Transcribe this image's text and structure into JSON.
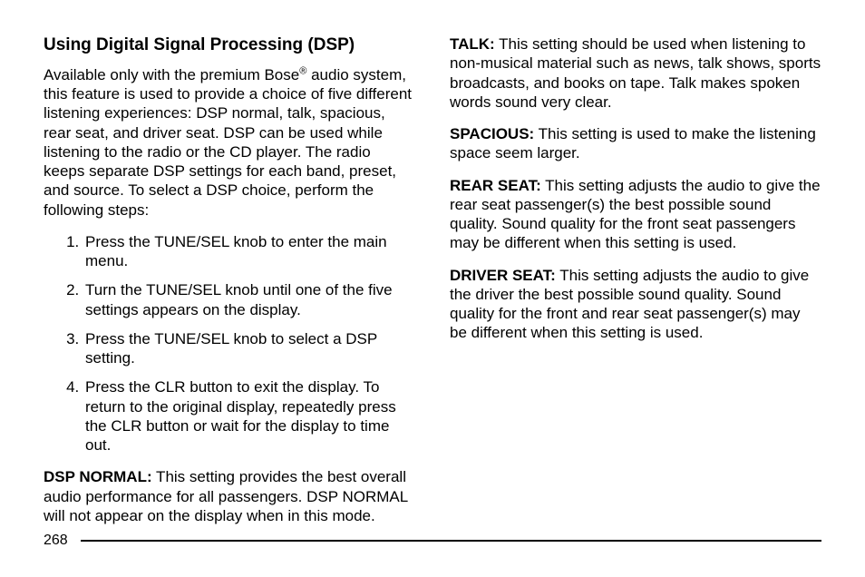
{
  "left": {
    "heading": "Using Digital Signal Processing (DSP)",
    "intro_a": "Available only with the premium Bose",
    "intro_sup": "®",
    "intro_b": " audio system, this feature is used to provide a choice of five different listening experiences: DSP normal, talk, spacious, rear seat, and driver seat. DSP can be used while listening to the radio or the CD player. The radio keeps separate DSP settings for each band, preset, and source. To select a DSP choice, perform the following steps:",
    "steps": [
      "Press the TUNE/SEL knob to enter the main menu.",
      "Turn the TUNE/SEL knob until one of the five settings appears on the display.",
      "Press the TUNE/SEL knob to select a DSP setting.",
      "Press the CLR button to exit the display. To return to the original display, repeatedly press the CLR button or wait for the display to time out."
    ],
    "dsp_normal_label": "DSP NORMAL:",
    "dsp_normal_text": "  This setting provides the best overall audio performance for all passengers. DSP NORMAL will not appear on the display when in this mode."
  },
  "right": {
    "talk_label": "TALK:",
    "talk_text": "  This setting should be used when listening to non-musical material such as news, talk shows, sports broadcasts, and books on tape. Talk makes spoken words sound very clear.",
    "spacious_label": "SPACIOUS:",
    "spacious_text": "  This setting is used to make the listening space seem larger.",
    "rear_label": "REAR SEAT:",
    "rear_text": "  This setting adjusts the audio to give the rear seat passenger(s) the best possible sound quality. Sound quality for the front seat passengers may be different when this setting is used.",
    "driver_label": "DRIVER SEAT:",
    "driver_text": "  This setting adjusts the audio to give the driver the best possible sound quality. Sound quality for the front and rear seat passenger(s) may be different when this setting is used."
  },
  "page_number": "268"
}
